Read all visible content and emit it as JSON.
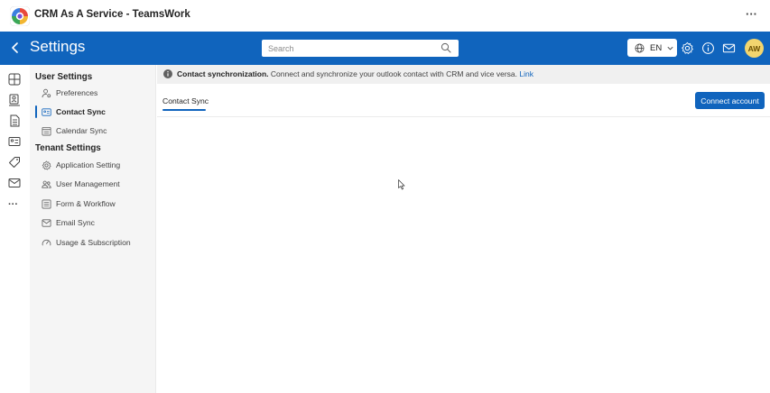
{
  "app": {
    "title": "CRM As A Service - TeamsWork",
    "more_label": "···"
  },
  "header": {
    "title": "Settings",
    "search_placeholder": "Search",
    "language": "EN",
    "avatar_initials": "AW",
    "bar_color": "#1064bd"
  },
  "rail": {
    "icons": [
      "grid-icon",
      "contacts-icon",
      "document-icon",
      "id-card-icon",
      "tag-icon",
      "mail-icon"
    ],
    "more_label": "···"
  },
  "sidebar": {
    "user_section_title": "User Settings",
    "tenant_section_title": "Tenant Settings",
    "items": [
      {
        "label": "Preferences",
        "icon": "person-settings-icon"
      },
      {
        "label": "Contact Sync",
        "icon": "contact-card-icon",
        "active": true
      },
      {
        "label": "Calendar Sync",
        "icon": "calendar-icon"
      },
      {
        "label": "Application Setting",
        "icon": "gear-icon"
      },
      {
        "label": "User Management",
        "icon": "people-icon"
      },
      {
        "label": "Form & Workflow",
        "icon": "form-icon"
      },
      {
        "label": "Email Sync",
        "icon": "mail-icon"
      },
      {
        "label": "Usage & Subscription",
        "icon": "gauge-icon"
      }
    ]
  },
  "content": {
    "banner_title": "Contact synchronization.",
    "banner_text": " Connect and synchronize your outlook contact with CRM and vice versa. ",
    "banner_link": "Link",
    "tab_label": "Contact Sync",
    "connect_button": "Connect account"
  }
}
